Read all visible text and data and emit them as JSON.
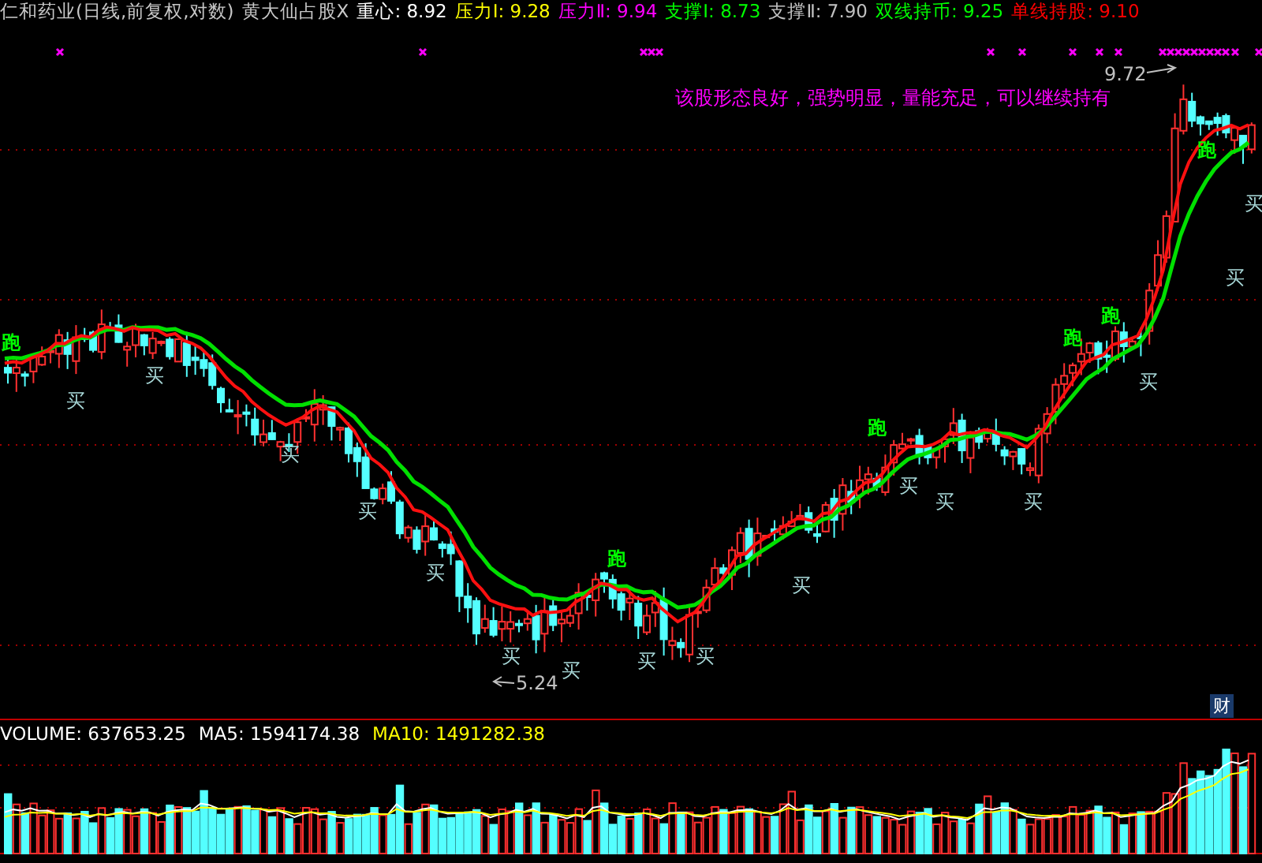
{
  "header": {
    "title": "仁和药业(日线,前复权,对数)",
    "indicator": "黄大仙占股X",
    "readings": [
      {
        "text": "重心: 8.92",
        "color": "#ffffff"
      },
      {
        "text": "压力Ⅰ: 9.28",
        "color": "#ffff00"
      },
      {
        "text": "压力Ⅱ: 9.94",
        "color": "#ff00ff"
      },
      {
        "text": "支撑Ⅰ: 8.73",
        "color": "#00ff00"
      },
      {
        "text": "支撑Ⅱ: 7.90",
        "color": "#c0c0c0"
      },
      {
        "text": "双线持币: 9.25",
        "color": "#00ff00"
      },
      {
        "text": "单线持股: 9.10",
        "color": "#ff0000"
      }
    ]
  },
  "comment": "该股形态良好，强势明显，量能充足，可以继续持有",
  "high_label": "9.72",
  "low_label": "5.24",
  "signals": [
    {
      "text": "跑",
      "kind": "run"
    },
    {
      "text": "买",
      "kind": "buy"
    },
    {
      "text": "买",
      "kind": "buy"
    },
    {
      "text": "买",
      "kind": "buy"
    },
    {
      "text": "买",
      "kind": "buy"
    },
    {
      "text": "买",
      "kind": "buy"
    },
    {
      "text": "买",
      "kind": "buy"
    },
    {
      "text": "买",
      "kind": "buy"
    },
    {
      "text": "跑",
      "kind": "run"
    },
    {
      "text": "买",
      "kind": "buy"
    },
    {
      "text": "买",
      "kind": "buy"
    },
    {
      "text": "买",
      "kind": "buy"
    },
    {
      "text": "跑",
      "kind": "run"
    },
    {
      "text": "买",
      "kind": "buy"
    },
    {
      "text": "买",
      "kind": "buy"
    },
    {
      "text": "买",
      "kind": "buy"
    },
    {
      "text": "跑",
      "kind": "run"
    },
    {
      "text": "跑",
      "kind": "run"
    },
    {
      "text": "买",
      "kind": "buy"
    },
    {
      "text": "跑",
      "kind": "run"
    },
    {
      "text": "买",
      "kind": "buy"
    },
    {
      "text": "买",
      "kind": "buy"
    }
  ],
  "finance_badge": "财",
  "volume": [
    {
      "text": "VOLUME: 637653.25",
      "color": "#ffffff"
    },
    {
      "text": "MA5: 1594174.38",
      "color": "#ffffff"
    },
    {
      "text": "MA10: 1491282.38",
      "color": "#ffff00"
    }
  ]
}
